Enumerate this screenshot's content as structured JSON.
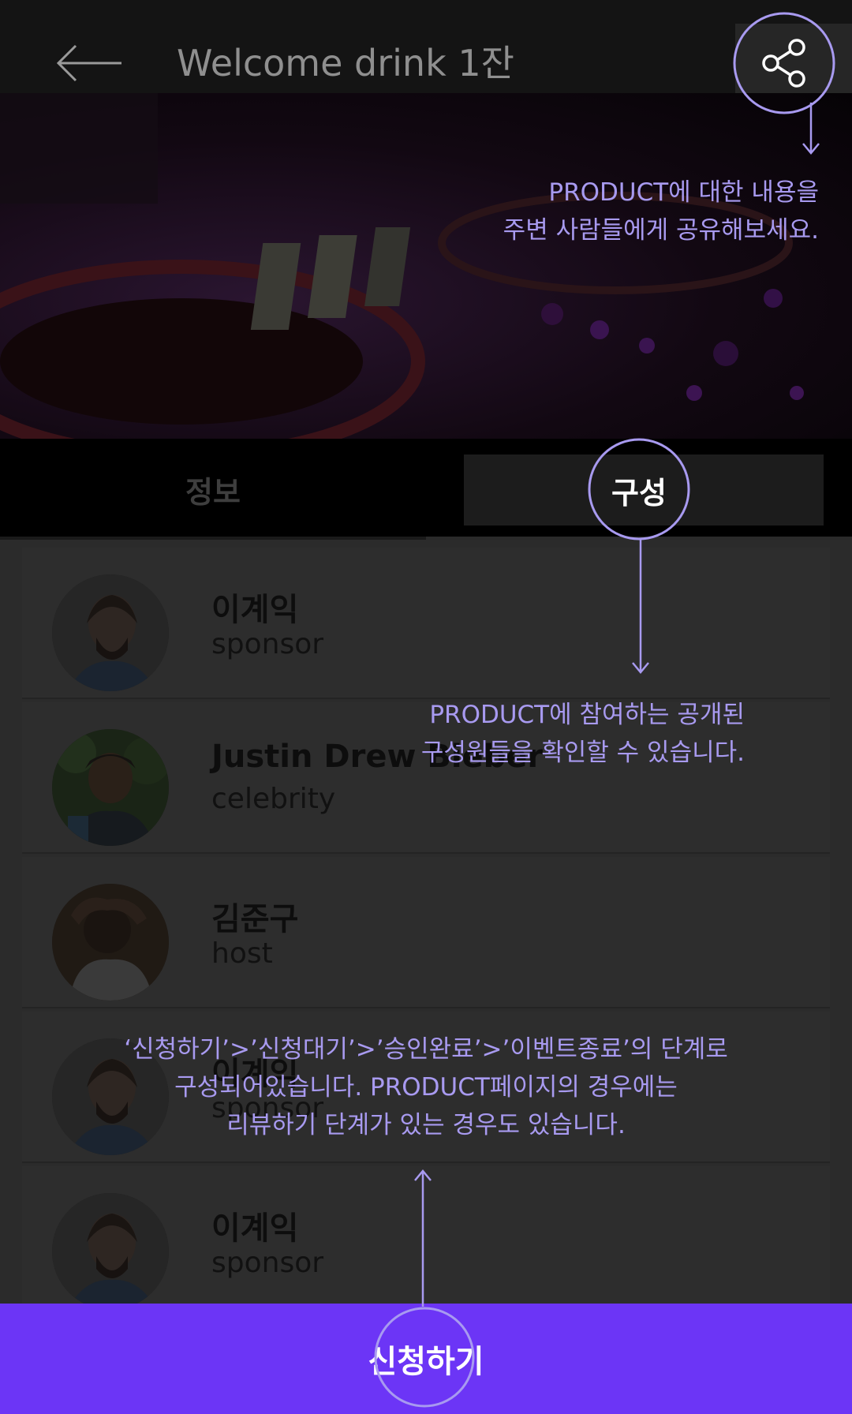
{
  "header": {
    "title": "Welcome drink 1잔",
    "back_icon": "arrow-left-icon",
    "share_icon": "share-icon"
  },
  "tabs": [
    {
      "label": "정보",
      "selected": false
    },
    {
      "label": "구성",
      "selected": true
    }
  ],
  "members": [
    {
      "name": "이계익",
      "role": "sponsor"
    },
    {
      "name": "Justin Drew Bieber",
      "role": "celebrity"
    },
    {
      "name": "김준구",
      "role": "host"
    },
    {
      "name": "이계익",
      "role": "sponsor"
    },
    {
      "name": "이계익",
      "role": "sponsor"
    }
  ],
  "apply_button": {
    "label": "신청하기"
  },
  "guide": {
    "share_lines": [
      "PRODUCT에 대한 내용을",
      "주변 사람들에게 공유해보세요."
    ],
    "members_lines": [
      "PRODUCT에 참여하는 공개된",
      "구성원들을 확인할 수 있습니다."
    ],
    "apply_lines": [
      "‘신청하기’>’신청대기’>’승인완료’>’이벤트종료’의 단계로",
      "구성되어있습니다. PRODUCT페이지의 경우에는",
      "리뷰하기 단계가 있는 경우도 있습니다."
    ]
  },
  "colors": {
    "accent": "#6c35f6",
    "guide": "#a89af0"
  }
}
